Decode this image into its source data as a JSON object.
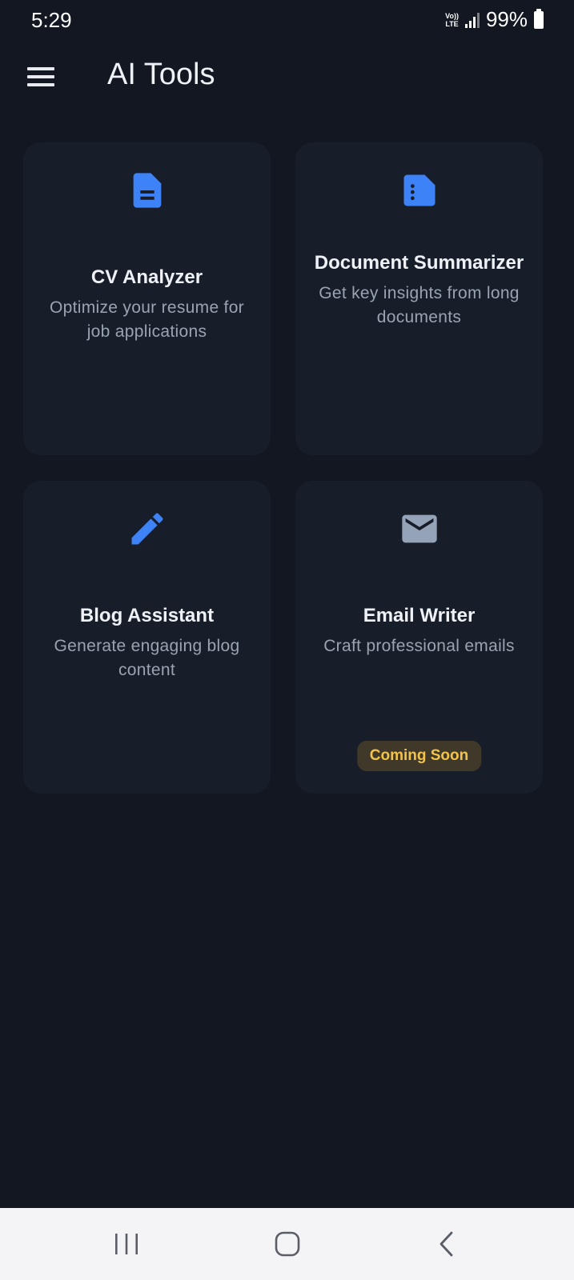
{
  "status_bar": {
    "time": "5:29",
    "network_line1": "Vo))",
    "network_line2": "LTE",
    "battery_percent": "99%"
  },
  "app_bar": {
    "title": "AI Tools",
    "menu_icon": "hamburger-menu-icon"
  },
  "tools": [
    {
      "title": "CV Analyzer",
      "description": "Optimize your resume for job applications",
      "icon": "document-icon",
      "icon_color": "#3d82f6"
    },
    {
      "title": "Document Summarizer",
      "description": "Get key insights from long documents",
      "icon": "summary-icon",
      "icon_color": "#3d82f6"
    },
    {
      "title": "Blog Assistant",
      "description": "Generate engaging blog content",
      "icon": "pencil-icon",
      "icon_color": "#3d82f6"
    },
    {
      "title": "Email Writer",
      "description": "Craft professional emails",
      "icon": "email-icon",
      "icon_color": "#94a3b8",
      "badge": "Coming Soon"
    }
  ],
  "colors": {
    "background": "#121722",
    "card": "#181e29",
    "accent": "#3d82f6",
    "badge_text": "#f2c34b",
    "badge_bg": "#40392a"
  },
  "nav_bar": {
    "icons": [
      "recent-apps-icon",
      "home-icon",
      "back-icon"
    ]
  }
}
